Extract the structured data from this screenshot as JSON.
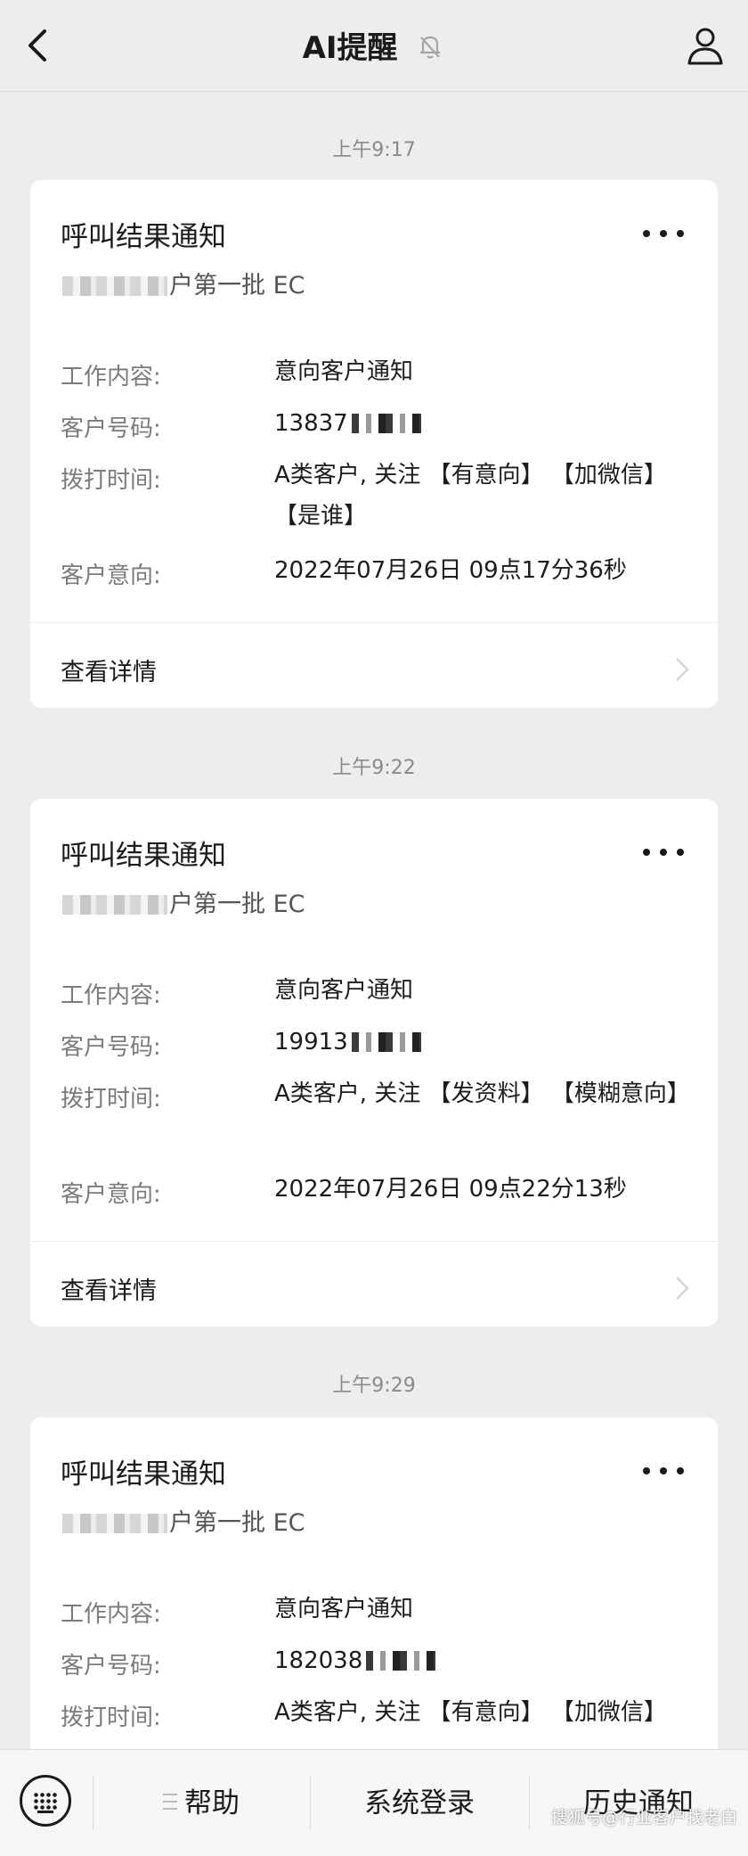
{
  "header": {
    "title": "AI提醒"
  },
  "messages": [
    {
      "time": "上午9:17",
      "title": "呼叫结果通知",
      "subtitle_visible": "户第一批 EC",
      "rows": [
        {
          "label": "工作内容:",
          "value": "意向客户通知"
        },
        {
          "label": "客户号码:",
          "value": "13837"
        },
        {
          "label": "拨打时间:",
          "value": "A类客户, 关注 【有意向】 【加微信】 【是谁】"
        },
        {
          "label": "客户意向:",
          "value": "2022年07月26日 09点17分36秒"
        }
      ],
      "detail": "查看详情"
    },
    {
      "time": "上午9:22",
      "title": "呼叫结果通知",
      "subtitle_visible": "户第一批 EC",
      "rows": [
        {
          "label": "工作内容:",
          "value": "意向客户通知"
        },
        {
          "label": "客户号码:",
          "value": "19913"
        },
        {
          "label": "拨打时间:",
          "value": "A类客户, 关注 【发资料】 【模糊意向】"
        },
        {
          "label": "客户意向:",
          "value": "2022年07月26日 09点22分13秒"
        }
      ],
      "detail": "查看详情"
    },
    {
      "time": "上午9:29",
      "title": "呼叫结果通知",
      "subtitle_visible": "户第一批 EC",
      "rows": [
        {
          "label": "工作内容:",
          "value": "意向客户通知"
        },
        {
          "label": "客户号码:",
          "value": "182038"
        },
        {
          "label": "拨打时间:",
          "value": "A类客户, 关注 【有意向】 【加微信】"
        }
      ]
    }
  ],
  "bottom_bar": {
    "help": "帮助",
    "login": "系统登录",
    "history": "历史通知"
  },
  "watermark": "搜狐号@行业客户找老白"
}
